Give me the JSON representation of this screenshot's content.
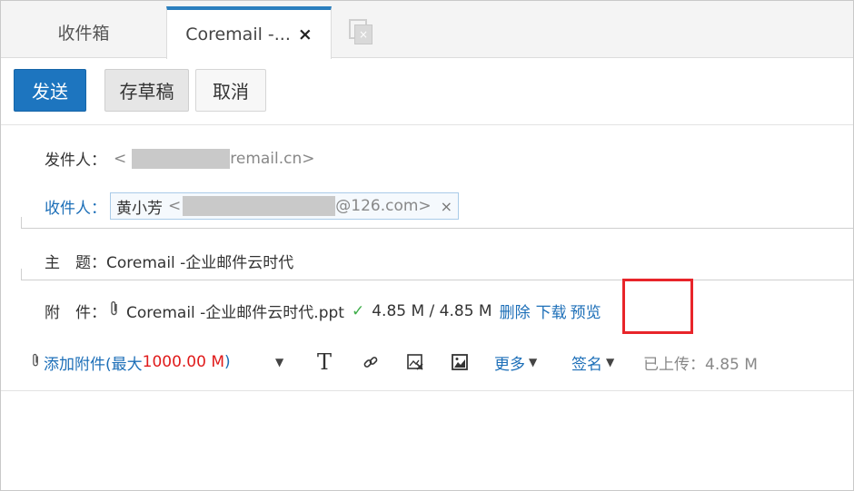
{
  "tabs": {
    "inbox": "收件箱",
    "compose": "Coremail -...",
    "compose_close": "×"
  },
  "toolbar": {
    "send": "发送",
    "draft": "存草稿",
    "cancel": "取消"
  },
  "from": {
    "label": "发件人：",
    "prefix": "<",
    "suffix": "remail.cn>"
  },
  "to": {
    "label": "收件人：",
    "name": "黄小芳",
    "prefix": "<",
    "suffix": "@126.com>",
    "remove": "×"
  },
  "subject": {
    "label": "主　题：",
    "value": "Coremail -企业邮件云时代"
  },
  "attachment": {
    "label": "附　件：",
    "filename": "Coremail -企业邮件云时代.ppt",
    "progress": "4.85 M / 4.85 M",
    "delete": "删除",
    "download": "下载",
    "preview": "预览"
  },
  "editor_toolbar": {
    "add_attachment": "添加附件(最大",
    "max_size": "1000.00 M",
    "close_paren": ")",
    "more": "更多",
    "signature": "签名",
    "uploaded": "已上传：4.85 M"
  },
  "colors": {
    "accent": "#1d75bf",
    "highlight": "#e8252a",
    "success": "#3fae4a",
    "limit": "#e01b1b"
  }
}
